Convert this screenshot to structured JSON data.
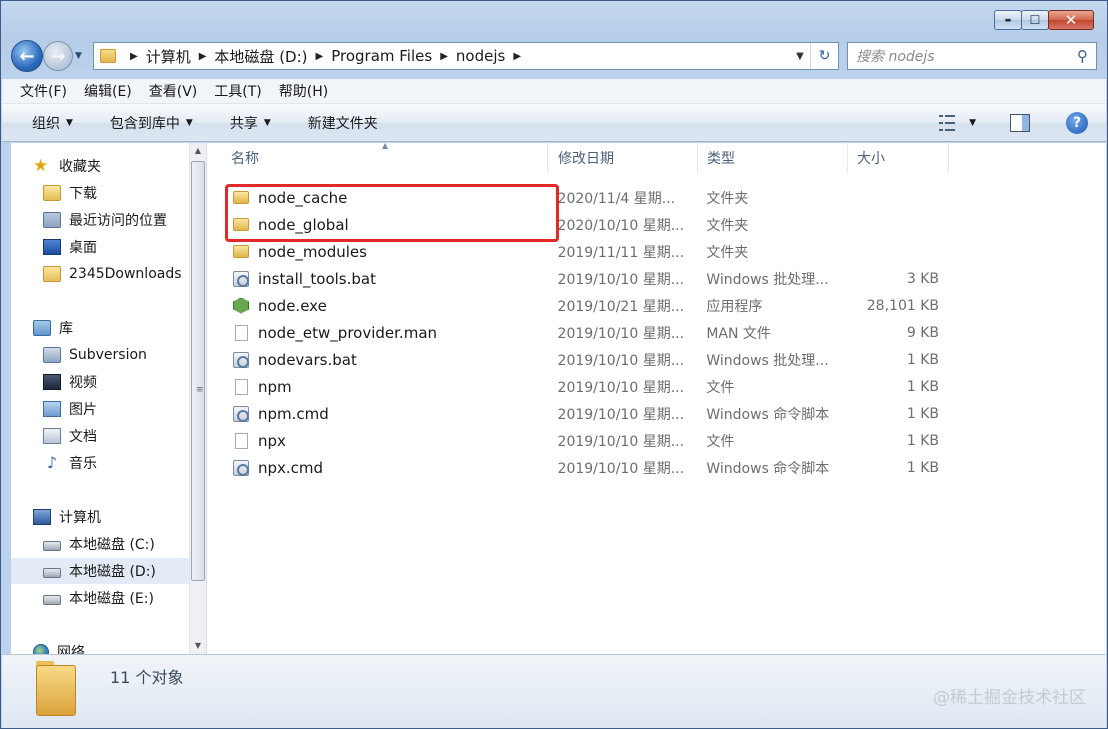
{
  "window": {
    "caption_buttons": {
      "minimize": "▬",
      "maximize": "☐",
      "close": "✕"
    }
  },
  "address": {
    "crumbs": [
      "计算机",
      "本地磁盘 (D:)",
      "Program Files",
      "nodejs"
    ]
  },
  "search": {
    "placeholder": "搜索 nodejs"
  },
  "menubar": [
    "文件(F)",
    "编辑(E)",
    "查看(V)",
    "工具(T)",
    "帮助(H)"
  ],
  "toolbar": {
    "organize": "组织",
    "include_library": "包含到库中",
    "share": "共享",
    "new_folder": "新建文件夹"
  },
  "nav": {
    "favorites": "收藏夹",
    "fav_items": [
      "下载",
      "最近访问的位置",
      "桌面",
      "2345Downloads"
    ],
    "libraries": "库",
    "lib_items": [
      "Subversion",
      "视频",
      "图片",
      "文档",
      "音乐"
    ],
    "computer": "计算机",
    "drives": [
      "本地磁盘 (C:)",
      "本地磁盘 (D:)",
      "本地磁盘 (E:)"
    ],
    "network": "网络"
  },
  "columns": {
    "name": "名称",
    "date": "修改日期",
    "type": "类型",
    "size": "大小"
  },
  "files": [
    {
      "name": "node_cache",
      "date": "2020/11/4 星期...",
      "type": "文件夹",
      "size": "",
      "icon": "folder-icon"
    },
    {
      "name": "node_global",
      "date": "2020/10/10 星期...",
      "type": "文件夹",
      "size": "",
      "icon": "folder-icon"
    },
    {
      "name": "node_modules",
      "date": "2019/11/11 星期...",
      "type": "文件夹",
      "size": "",
      "icon": "folder-icon"
    },
    {
      "name": "install_tools.bat",
      "date": "2019/10/10 星期...",
      "type": "Windows 批处理...",
      "size": "3 KB",
      "icon": "batch-file-icon"
    },
    {
      "name": "node.exe",
      "date": "2019/10/21 星期...",
      "type": "应用程序",
      "size": "28,101 KB",
      "icon": "node-exe-icon"
    },
    {
      "name": "node_etw_provider.man",
      "date": "2019/10/10 星期...",
      "type": "MAN 文件",
      "size": "9 KB",
      "icon": "file-icon"
    },
    {
      "name": "nodevars.bat",
      "date": "2019/10/10 星期...",
      "type": "Windows 批处理...",
      "size": "1 KB",
      "icon": "batch-file-icon"
    },
    {
      "name": "npm",
      "date": "2019/10/10 星期...",
      "type": "文件",
      "size": "1 KB",
      "icon": "file-icon"
    },
    {
      "name": "npm.cmd",
      "date": "2019/10/10 星期...",
      "type": "Windows 命令脚本",
      "size": "1 KB",
      "icon": "batch-file-icon"
    },
    {
      "name": "npx",
      "date": "2019/10/10 星期...",
      "type": "文件",
      "size": "1 KB",
      "icon": "file-icon"
    },
    {
      "name": "npx.cmd",
      "date": "2019/10/10 星期...",
      "type": "Windows 命令脚本",
      "size": "1 KB",
      "icon": "batch-file-icon"
    }
  ],
  "details": {
    "count": "11 个对象"
  },
  "watermark": "@稀土掘金技术社区",
  "colors": {
    "highlight": "#e2292a",
    "selected_bg": "#e3ecf6"
  }
}
